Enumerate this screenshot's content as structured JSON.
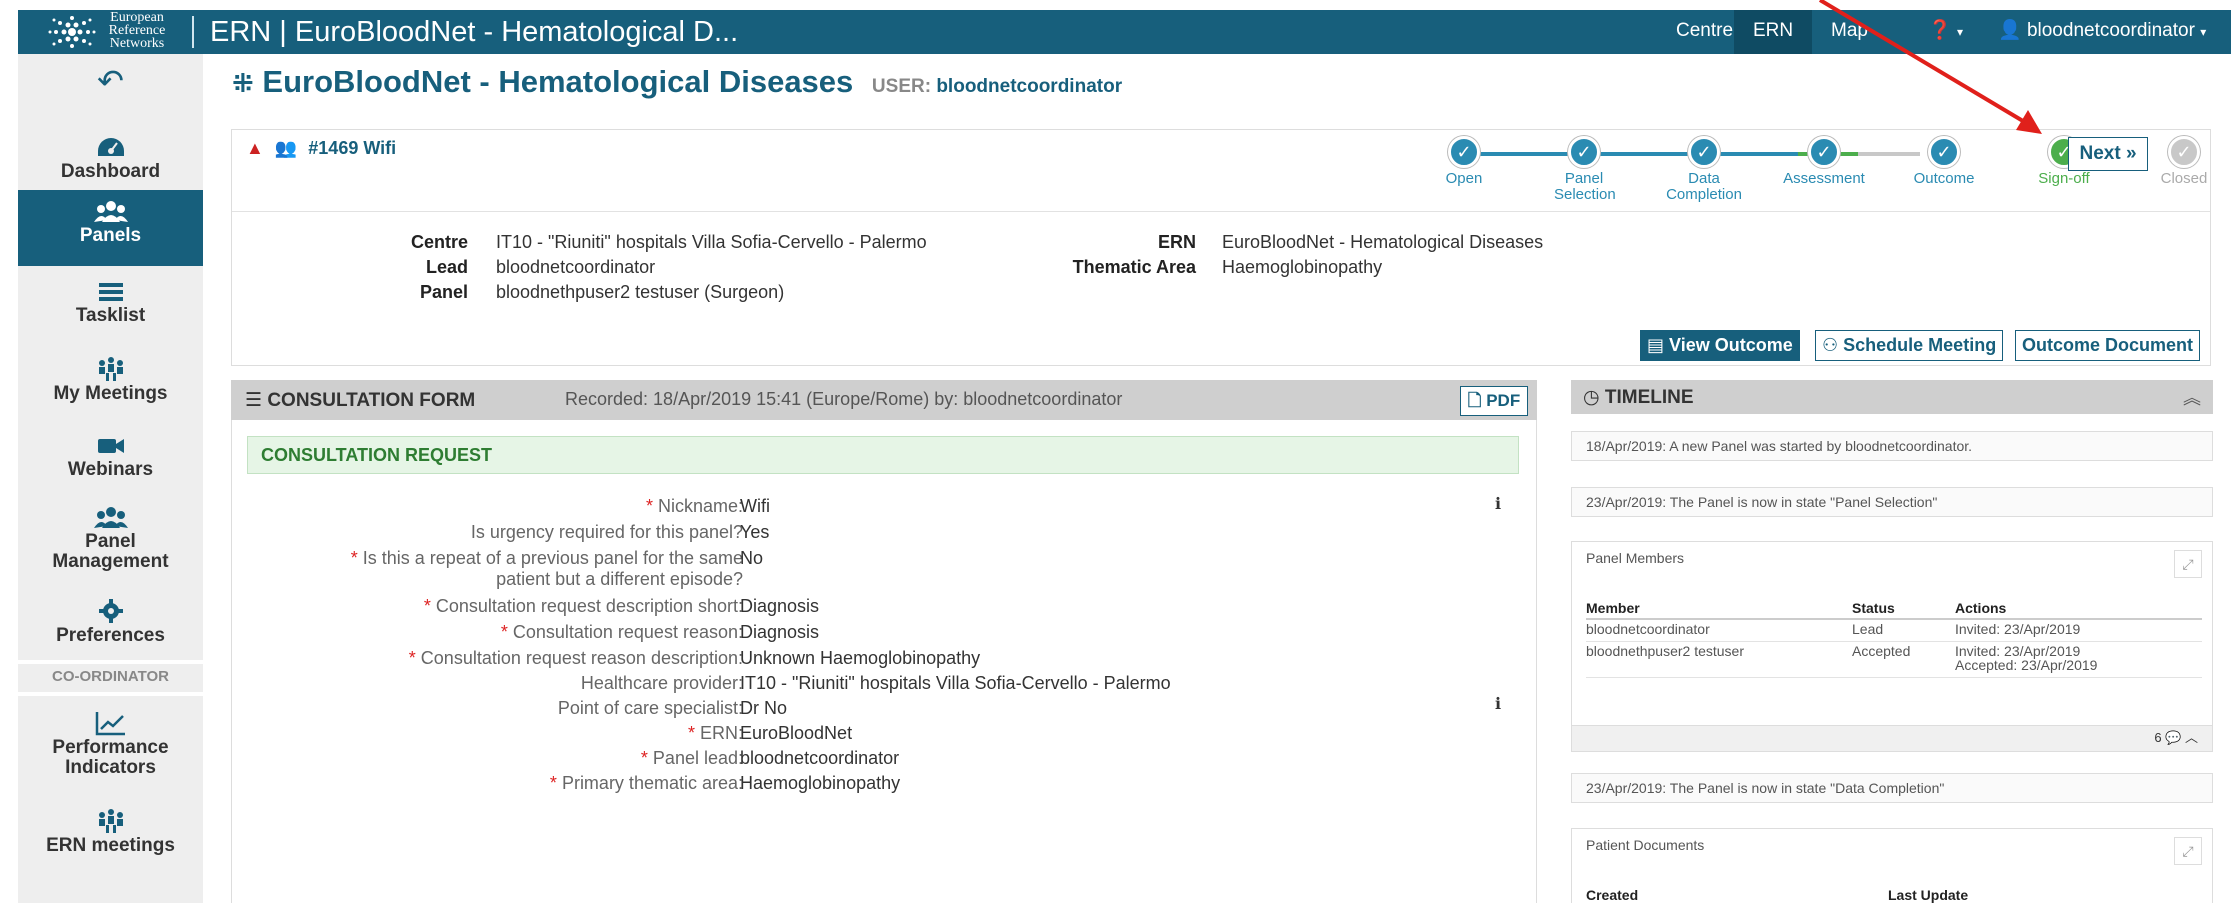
{
  "topbar": {
    "logo_text_1": "European",
    "logo_text_2": "Reference",
    "logo_text_3": "Networks",
    "app_title": "ERN | EuroBloodNet - Hematological D...",
    "nav_centre": "Centre",
    "nav_ern": "ERN",
    "nav_map": "Map",
    "help_icon": "question-circle-icon",
    "user_menu": "bloodnetcoordinator",
    "colors": {
      "bar": "#175f7c",
      "active": "#0f4b63"
    }
  },
  "sidebar": {
    "back_icon": "reply-arrow-icon",
    "items": [
      {
        "label": "Dashboard",
        "icon": "tachometer-icon"
      },
      {
        "label": "Panels",
        "icon": "users-icon"
      },
      {
        "label": "Tasklist",
        "icon": "list-icon"
      },
      {
        "label": "My Meetings",
        "icon": "meeting-icon"
      },
      {
        "label": "Webinars",
        "icon": "video-camera-icon"
      },
      {
        "label": "Panel Management",
        "icon": "users-icon"
      },
      {
        "label": "Preferences",
        "icon": "gear-icon"
      },
      {
        "label": "Performance Indicators",
        "icon": "line-chart-icon"
      },
      {
        "label": "ERN meetings",
        "icon": "meeting-icon"
      }
    ],
    "section_label": "CO-ORDINATOR"
  },
  "heading": {
    "icon": "network-icon",
    "title": "EuroBloodNet - Hematological Diseases",
    "user_label": "USER:",
    "user_value": "bloodnetcoordinator"
  },
  "case": {
    "id_label": "#1469 Wifi",
    "warn_icon": "warning-icon",
    "group_icon": "users-icon",
    "steps": [
      {
        "label": "Open",
        "state": "done"
      },
      {
        "label": "Panel Selection",
        "state": "done"
      },
      {
        "label": "Data Completion",
        "state": "done"
      },
      {
        "label": "Assessment",
        "state": "done"
      },
      {
        "label": "Outcome",
        "state": "done"
      },
      {
        "label": "Sign-off",
        "state": "current"
      },
      {
        "label": "Closed",
        "state": "todo"
      }
    ],
    "step_colors": {
      "done": "#2a8bb2",
      "current": "#4cae4c",
      "todo": "#c8c8c8"
    },
    "next_label": "Next »",
    "fields_left": [
      {
        "key": "Centre",
        "value": "IT10 - \"Riuniti\" hospitals Villa Sofia-Cervello - Palermo"
      },
      {
        "key": "Lead",
        "value": "bloodnetcoordinator"
      },
      {
        "key": "Panel",
        "value": "bloodnethpuser2 testuser (Surgeon)"
      }
    ],
    "fields_right": [
      {
        "key": "ERN",
        "value": "EuroBloodNet - Hematological Diseases"
      },
      {
        "key": "Thematic Area",
        "value": "Haemoglobinopathy"
      }
    ],
    "btn_view_outcome": "View Outcome",
    "btn_schedule_meeting": "Schedule Meeting",
    "btn_outcome_document": "Outcome Document"
  },
  "form": {
    "title": "CONSULTATION FORM",
    "recorded": "Recorded: 18/Apr/2019 15:41 (Europe/Rome) by: bloodnetcoordinator",
    "pdf_label": "PDF",
    "section_title": "CONSULTATION REQUEST",
    "rows": [
      {
        "label": "Nickname:",
        "required": true,
        "value": "Wifi",
        "info": true
      },
      {
        "label": "Is urgency required for this panel?",
        "required": false,
        "value": "Yes",
        "info": false
      },
      {
        "label": "Is this a repeat of a previous panel for the same patient but a different episode?",
        "required": true,
        "value": "No",
        "info": false
      },
      {
        "label": "Consultation request description short:",
        "required": true,
        "value": "Diagnosis",
        "info": false
      },
      {
        "label": "Consultation request reason:",
        "required": true,
        "value": "Diagnosis",
        "info": false
      },
      {
        "label": "Consultation request reason description:",
        "required": true,
        "value": "Unknown Haemoglobinopathy",
        "info": false
      },
      {
        "label": "Healthcare provider:",
        "required": false,
        "value": "IT10 - \"Riuniti\" hospitals Villa Sofia-Cervello - Palermo",
        "info": false
      },
      {
        "label": "Point of care specialist:",
        "required": false,
        "value": "Dr No",
        "info": true
      },
      {
        "label": "ERN:",
        "required": true,
        "value": "EuroBloodNet",
        "info": false
      },
      {
        "label": "Panel lead:",
        "required": true,
        "value": "bloodnetcoordinator",
        "info": false
      },
      {
        "label": "Primary thematic area:",
        "required": true,
        "value": "Haemoglobinopathy",
        "info": false
      }
    ]
  },
  "timeline": {
    "title": "TIMELINE",
    "event_1": "18/Apr/2019: A new Panel was started by bloodnetcoordinator.",
    "event_2": "23/Apr/2019: The Panel is now in state \"Panel Selection\"",
    "members_title": "Panel Members",
    "members_headers": [
      "Member",
      "Status",
      "Actions"
    ],
    "members": [
      {
        "member": "bloodnetcoordinator",
        "status": "Lead",
        "actions_1": "Invited: 23/Apr/2019",
        "actions_2": ""
      },
      {
        "member": "bloodnethpuser2 testuser",
        "status": "Accepted",
        "actions_1": "Invited: 23/Apr/2019",
        "actions_2": "Accepted: 23/Apr/2019"
      }
    ],
    "comment_count": "6",
    "event_3": "23/Apr/2019: The Panel is now in state \"Data Completion\"",
    "documents_title": "Patient Documents",
    "documents_headers": [
      "Created",
      "Last Update"
    ]
  }
}
